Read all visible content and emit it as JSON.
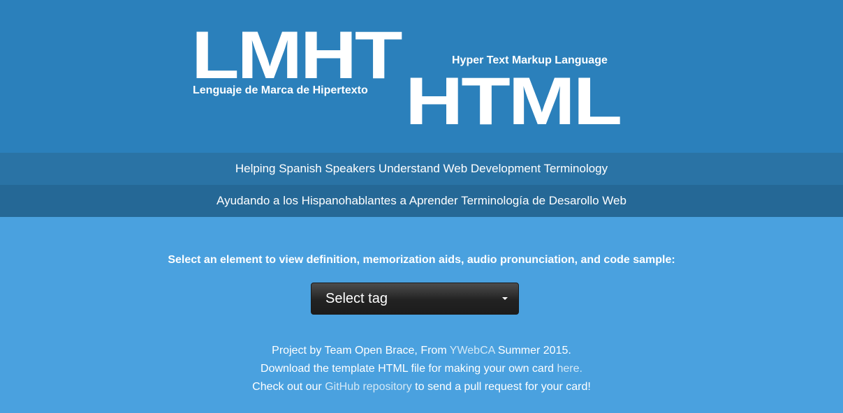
{
  "logo": {
    "big_es": "LMHT",
    "big_en": "HTML",
    "subtitle_es": "Lenguaje de Marca de Hipertexto",
    "subtitle_en": "Hyper Text Markup Language"
  },
  "tagline": {
    "english": "Helping Spanish Speakers Understand Web Development Terminology",
    "spanish": "Ayudando a los Hispanohablantes a Aprender Terminología de Desarollo Web"
  },
  "main": {
    "prompt": "Select an element to view definition, memorization aids, audio pronunciation, and code sample:",
    "select": {
      "selected": "Select tag"
    }
  },
  "footer": {
    "line1": {
      "before": "Project by Team Open Brace, From ",
      "link": "YWebCA",
      "after": " Summer 2015."
    },
    "line2": {
      "before": "Download the template HTML file for making your own card ",
      "link": "here."
    },
    "line3": {
      "before": "Check out our ",
      "link": "GitHub repository",
      "after": " to send a pull request for your card!"
    }
  },
  "colors": {
    "header_bg": "#2b80bb",
    "band_english_bg": "#2a73a5",
    "band_spanish_bg": "#256896",
    "page_bg": "#4aa1df",
    "link": "#d3e8f6",
    "select_bg": "#222222"
  },
  "icons": {
    "select_caret": "caret-down-icon"
  }
}
